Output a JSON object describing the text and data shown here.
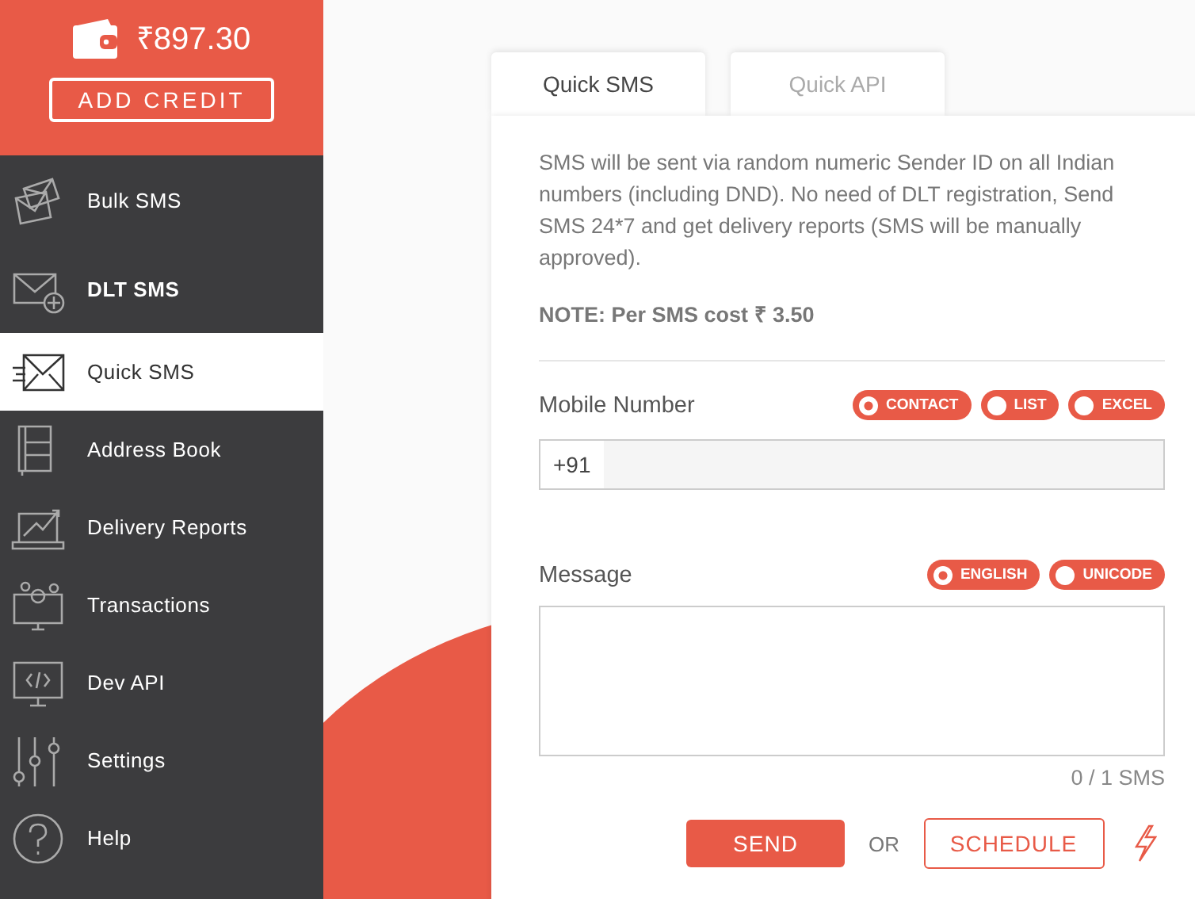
{
  "sidebar": {
    "balance": "₹897.30",
    "add_credit": "ADD CREDIT",
    "items": [
      {
        "label": "Bulk SMS",
        "selected": false,
        "bold": false
      },
      {
        "label": "DLT SMS",
        "selected": false,
        "bold": true
      },
      {
        "label": "Quick SMS",
        "selected": true,
        "bold": false
      },
      {
        "label": "Address Book",
        "selected": false,
        "bold": false
      },
      {
        "label": "Delivery Reports",
        "selected": false,
        "bold": false
      },
      {
        "label": "Transactions",
        "selected": false,
        "bold": false
      },
      {
        "label": "Dev API",
        "selected": false,
        "bold": false
      },
      {
        "label": "Settings",
        "selected": false,
        "bold": false
      },
      {
        "label": "Help",
        "selected": false,
        "bold": false
      }
    ]
  },
  "tabs": [
    {
      "label": "Quick SMS",
      "selected": true
    },
    {
      "label": "Quick API",
      "selected": false
    }
  ],
  "description": "SMS will be sent via random numeric Sender ID on all Indian numbers (including DND). No need of DLT registration, Send SMS 24*7 and get delivery reports (SMS will be manually approved).",
  "note": "NOTE: Per SMS cost ₹ 3.50",
  "mobile": {
    "label": "Mobile Number",
    "prefix": "+91",
    "options": [
      {
        "label": "CONTACT",
        "selected": true
      },
      {
        "label": "LIST",
        "selected": false
      },
      {
        "label": "EXCEL",
        "selected": false
      }
    ]
  },
  "message": {
    "label": "Message",
    "options": [
      {
        "label": "ENGLISH",
        "selected": true
      },
      {
        "label": "UNICODE",
        "selected": false
      }
    ],
    "counter": "0 / 1 SMS"
  },
  "actions": {
    "send": "SEND",
    "or": "OR",
    "schedule": "SCHEDULE"
  }
}
